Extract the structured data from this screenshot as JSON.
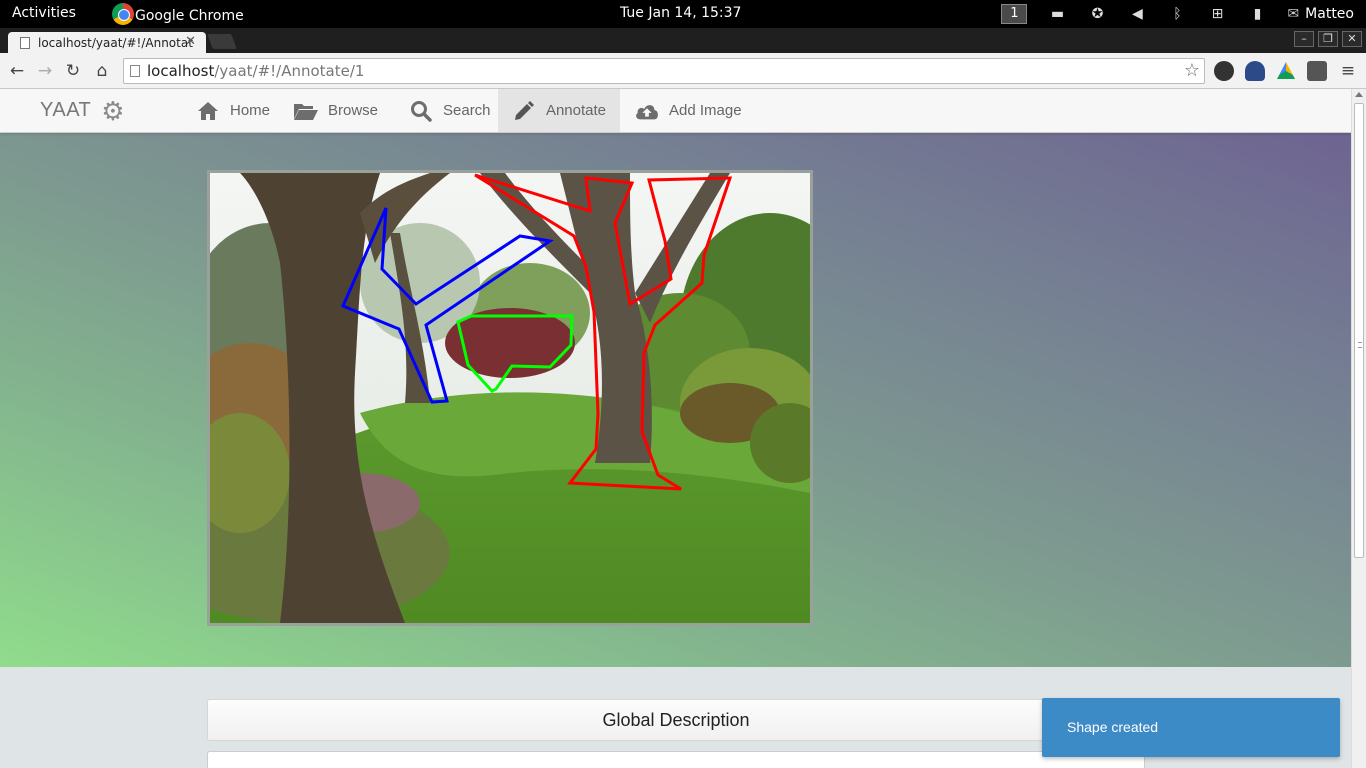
{
  "topbar": {
    "activities": "Activities",
    "app_name": "Google Chrome",
    "clock": "Tue Jan 14, 15:37",
    "workspace": "1",
    "user": "Matteo"
  },
  "browser": {
    "tab_title": "localhost/yaat/#!/Annotat",
    "url_host": "localhost",
    "url_path": "/yaat/#!/Annotate/1"
  },
  "app": {
    "brand": "YAAT",
    "nav": [
      {
        "label": "Home",
        "icon": "home-icon"
      },
      {
        "label": "Browse",
        "icon": "folder-open-icon"
      },
      {
        "label": "Search",
        "icon": "search-icon"
      },
      {
        "label": "Annotate",
        "icon": "pencil-icon",
        "active": true
      },
      {
        "label": "Add Image",
        "icon": "cloud-upload-icon"
      }
    ],
    "global_description": "Global Description",
    "toast": "Shape created"
  },
  "annotations": [
    {
      "label": "blue-shape",
      "color": "#0000ff"
    },
    {
      "label": "green-shape",
      "color": "#00ff00"
    },
    {
      "label": "red-shape",
      "color": "#ff0000"
    }
  ]
}
